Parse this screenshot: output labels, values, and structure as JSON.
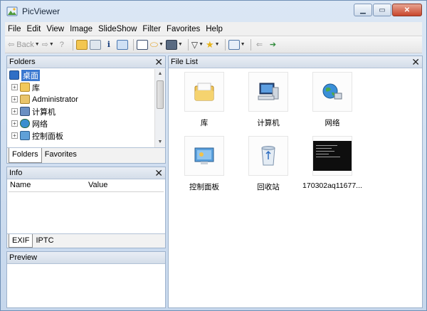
{
  "window": {
    "title": "PicViewer"
  },
  "menu": [
    "File",
    "Edit",
    "View",
    "Image",
    "SlideShow",
    "Filter",
    "Favorites",
    "Help"
  ],
  "menu_accel": [
    "F",
    "E",
    "V",
    "I",
    "S",
    "F",
    "a",
    "H"
  ],
  "toolbar": {
    "back_label": "Back"
  },
  "folders": {
    "header": "Folders",
    "selected": "桌面",
    "items": [
      "库",
      "Administrator",
      "计算机",
      "网络",
      "控制面板"
    ],
    "tabs": [
      "Folders",
      "Favorites"
    ]
  },
  "info": {
    "header": "Info",
    "columns": [
      "Name",
      "Value"
    ],
    "tabs": [
      "EXIF",
      "IPTC"
    ]
  },
  "preview": {
    "header": "Preview"
  },
  "filelist": {
    "header": "File List",
    "items": [
      "库",
      "计算机",
      "网络",
      "控制面板",
      "回收站",
      "170302aq11677..."
    ]
  },
  "colors": {
    "selection": "#3a78d0",
    "close_button": "#c8462c",
    "panel_header": "#d4dde9"
  }
}
